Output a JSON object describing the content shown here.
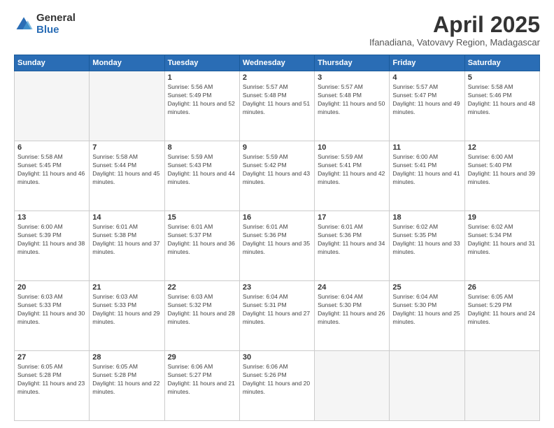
{
  "logo": {
    "general": "General",
    "blue": "Blue"
  },
  "header": {
    "title": "April 2025",
    "subtitle": "Ifanadiana, Vatovavy Region, Madagascar"
  },
  "weekdays": [
    "Sunday",
    "Monday",
    "Tuesday",
    "Wednesday",
    "Thursday",
    "Friday",
    "Saturday"
  ],
  "days": {
    "1": {
      "sunrise": "5:56 AM",
      "sunset": "5:49 PM",
      "daylight": "11 hours and 52 minutes."
    },
    "2": {
      "sunrise": "5:57 AM",
      "sunset": "5:48 PM",
      "daylight": "11 hours and 51 minutes."
    },
    "3": {
      "sunrise": "5:57 AM",
      "sunset": "5:48 PM",
      "daylight": "11 hours and 50 minutes."
    },
    "4": {
      "sunrise": "5:57 AM",
      "sunset": "5:47 PM",
      "daylight": "11 hours and 49 minutes."
    },
    "5": {
      "sunrise": "5:58 AM",
      "sunset": "5:46 PM",
      "daylight": "11 hours and 48 minutes."
    },
    "6": {
      "sunrise": "5:58 AM",
      "sunset": "5:45 PM",
      "daylight": "11 hours and 46 minutes."
    },
    "7": {
      "sunrise": "5:58 AM",
      "sunset": "5:44 PM",
      "daylight": "11 hours and 45 minutes."
    },
    "8": {
      "sunrise": "5:59 AM",
      "sunset": "5:43 PM",
      "daylight": "11 hours and 44 minutes."
    },
    "9": {
      "sunrise": "5:59 AM",
      "sunset": "5:42 PM",
      "daylight": "11 hours and 43 minutes."
    },
    "10": {
      "sunrise": "5:59 AM",
      "sunset": "5:41 PM",
      "daylight": "11 hours and 42 minutes."
    },
    "11": {
      "sunrise": "6:00 AM",
      "sunset": "5:41 PM",
      "daylight": "11 hours and 41 minutes."
    },
    "12": {
      "sunrise": "6:00 AM",
      "sunset": "5:40 PM",
      "daylight": "11 hours and 39 minutes."
    },
    "13": {
      "sunrise": "6:00 AM",
      "sunset": "5:39 PM",
      "daylight": "11 hours and 38 minutes."
    },
    "14": {
      "sunrise": "6:01 AM",
      "sunset": "5:38 PM",
      "daylight": "11 hours and 37 minutes."
    },
    "15": {
      "sunrise": "6:01 AM",
      "sunset": "5:37 PM",
      "daylight": "11 hours and 36 minutes."
    },
    "16": {
      "sunrise": "6:01 AM",
      "sunset": "5:36 PM",
      "daylight": "11 hours and 35 minutes."
    },
    "17": {
      "sunrise": "6:01 AM",
      "sunset": "5:36 PM",
      "daylight": "11 hours and 34 minutes."
    },
    "18": {
      "sunrise": "6:02 AM",
      "sunset": "5:35 PM",
      "daylight": "11 hours and 33 minutes."
    },
    "19": {
      "sunrise": "6:02 AM",
      "sunset": "5:34 PM",
      "daylight": "11 hours and 31 minutes."
    },
    "20": {
      "sunrise": "6:03 AM",
      "sunset": "5:33 PM",
      "daylight": "11 hours and 30 minutes."
    },
    "21": {
      "sunrise": "6:03 AM",
      "sunset": "5:33 PM",
      "daylight": "11 hours and 29 minutes."
    },
    "22": {
      "sunrise": "6:03 AM",
      "sunset": "5:32 PM",
      "daylight": "11 hours and 28 minutes."
    },
    "23": {
      "sunrise": "6:04 AM",
      "sunset": "5:31 PM",
      "daylight": "11 hours and 27 minutes."
    },
    "24": {
      "sunrise": "6:04 AM",
      "sunset": "5:30 PM",
      "daylight": "11 hours and 26 minutes."
    },
    "25": {
      "sunrise": "6:04 AM",
      "sunset": "5:30 PM",
      "daylight": "11 hours and 25 minutes."
    },
    "26": {
      "sunrise": "6:05 AM",
      "sunset": "5:29 PM",
      "daylight": "11 hours and 24 minutes."
    },
    "27": {
      "sunrise": "6:05 AM",
      "sunset": "5:28 PM",
      "daylight": "11 hours and 23 minutes."
    },
    "28": {
      "sunrise": "6:05 AM",
      "sunset": "5:28 PM",
      "daylight": "11 hours and 22 minutes."
    },
    "29": {
      "sunrise": "6:06 AM",
      "sunset": "5:27 PM",
      "daylight": "11 hours and 21 minutes."
    },
    "30": {
      "sunrise": "6:06 AM",
      "sunset": "5:26 PM",
      "daylight": "11 hours and 20 minutes."
    }
  },
  "labels": {
    "sunrise": "Sunrise:",
    "sunset": "Sunset:",
    "daylight": "Daylight:"
  }
}
